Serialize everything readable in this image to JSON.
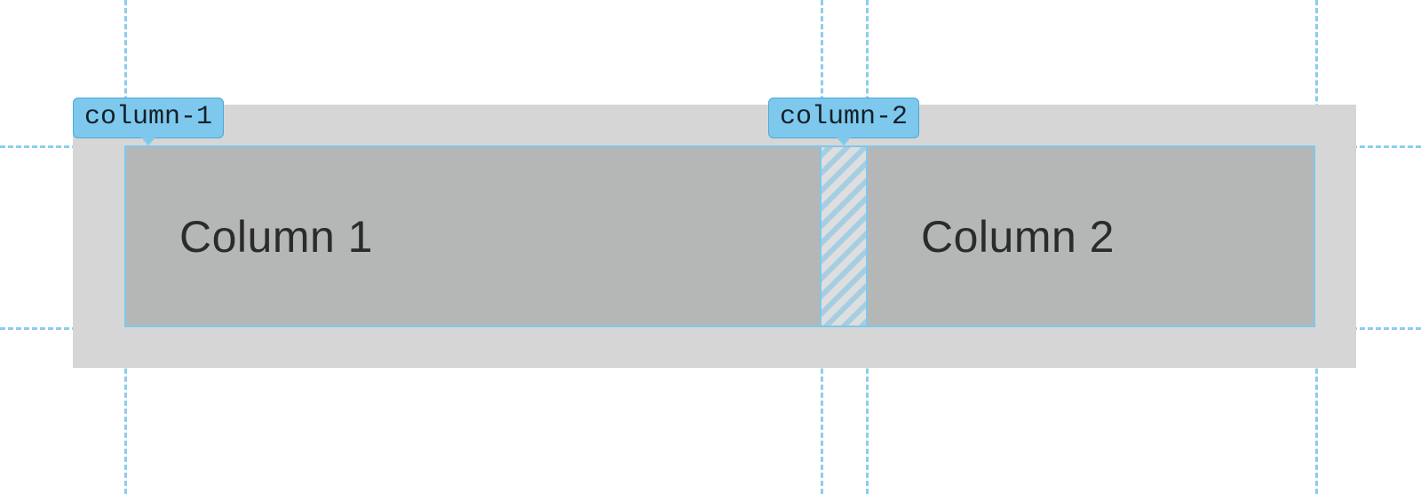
{
  "columns": {
    "col1": {
      "label": "column-1",
      "text": "Column 1"
    },
    "col2": {
      "label": "column-2",
      "text": "Column 2"
    }
  },
  "guides": {
    "horizontal": [
      164,
      369
    ],
    "vertical": [
      140,
      924,
      975,
      1481
    ]
  },
  "colors": {
    "guide": "#7ec8ed",
    "container": "#d6d6d6",
    "cell": "#b5b7b7",
    "badge": "#7ec8ed"
  }
}
